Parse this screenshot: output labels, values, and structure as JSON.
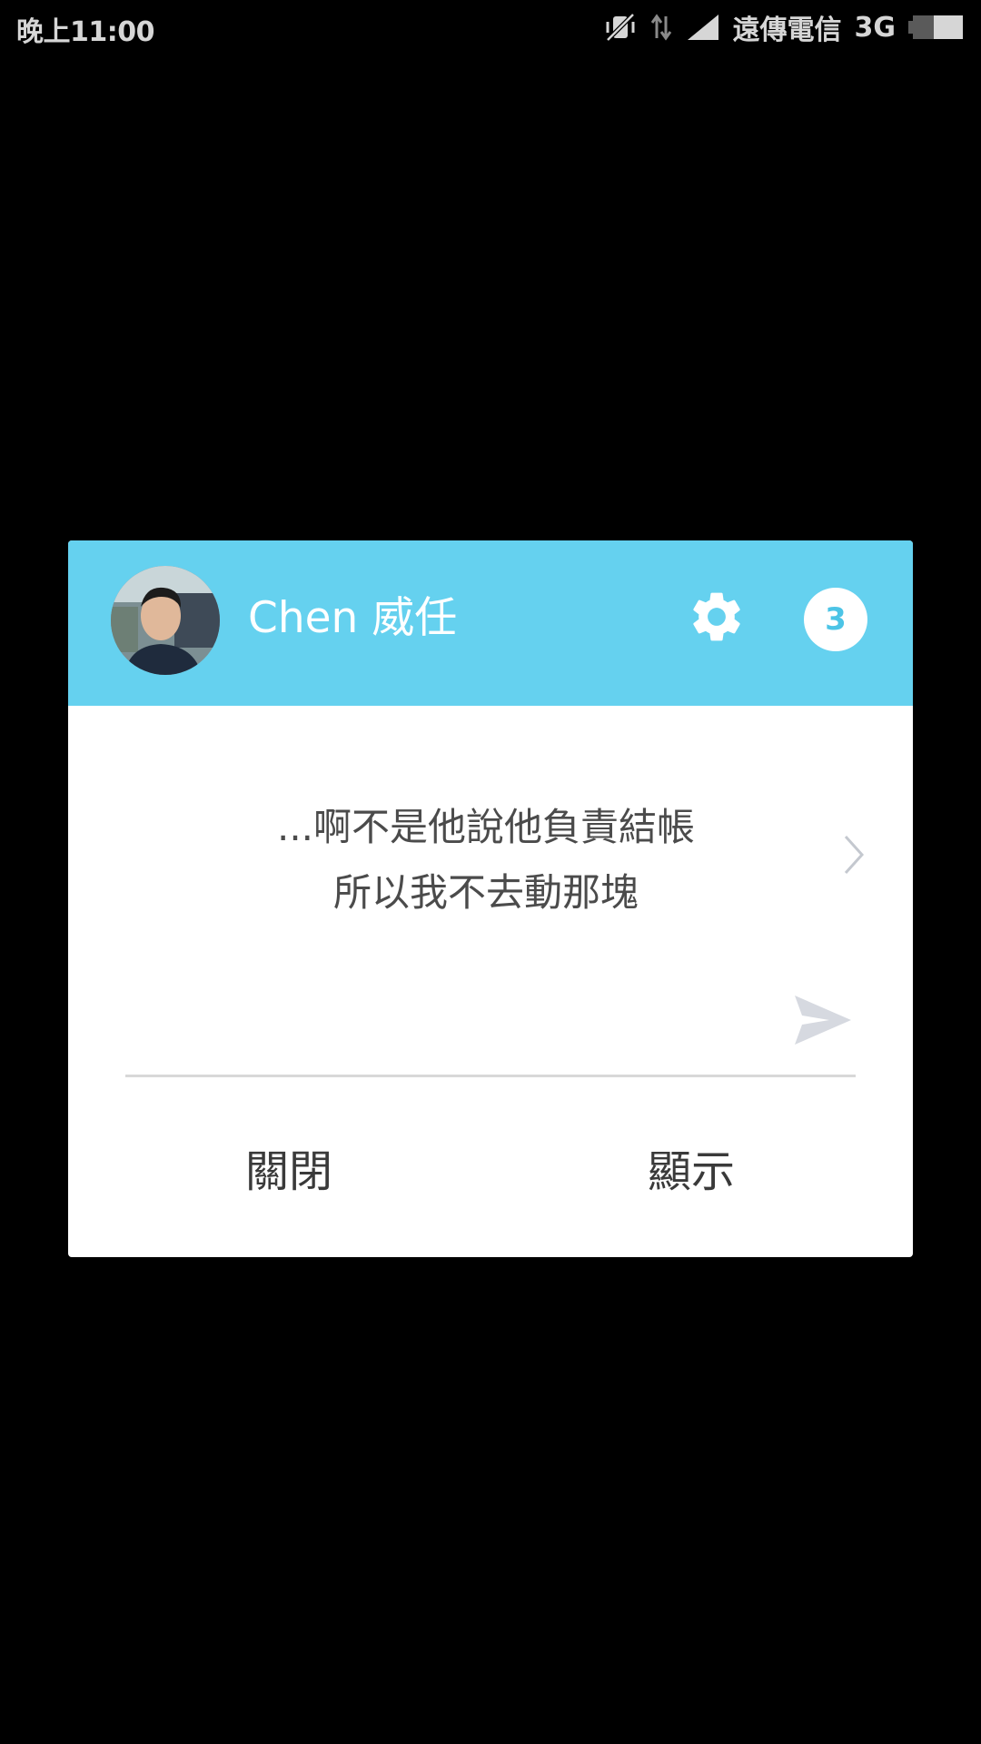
{
  "status_bar": {
    "time": "晚上11:00",
    "carrier": "遠傳電信",
    "network": "3G",
    "icons": [
      "muted-vibrate-icon",
      "data-arrows-icon",
      "signal-icon",
      "battery-icon"
    ]
  },
  "popup": {
    "sender_name": "Chen 威任",
    "unread_count": "3",
    "message_lines": [
      "...啊不是他說他負責結帳",
      "所以我不去動那塊"
    ],
    "reply_placeholder": "",
    "close_label": "關閉",
    "show_label": "顯示"
  },
  "colors": {
    "header_bg": "#65d1ef",
    "badge_text": "#4cc4e6",
    "background": "#000000",
    "dialog_bg": "#ffffff"
  }
}
